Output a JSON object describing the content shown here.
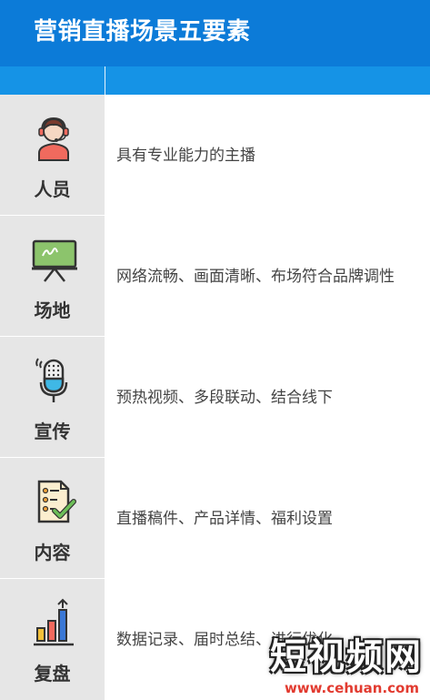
{
  "header": {
    "title": "营销直播场景五要素"
  },
  "rows": [
    {
      "name": "人员",
      "desc": "具有专业能力的主播",
      "icon": "host-headset-icon"
    },
    {
      "name": "场地",
      "desc": "网络流畅、画面清晰、布场符合品牌调性",
      "icon": "easel-board-icon"
    },
    {
      "name": "宣传",
      "desc": "预热视频、多段联动、结合线下",
      "icon": "microphone-icon"
    },
    {
      "name": "内容",
      "desc": "直播稿件、产品详情、福利设置",
      "icon": "checklist-icon"
    },
    {
      "name": "复盘",
      "desc": "数据记录、届时总结、进行优化",
      "icon": "bar-chart-icon"
    }
  ],
  "watermark": {
    "main": "短视频网",
    "url": "www.cehuan.com"
  },
  "colors": {
    "header": "#0c7bd8",
    "subheader": "#1593e6",
    "label_bg": "#e6e6e6"
  }
}
